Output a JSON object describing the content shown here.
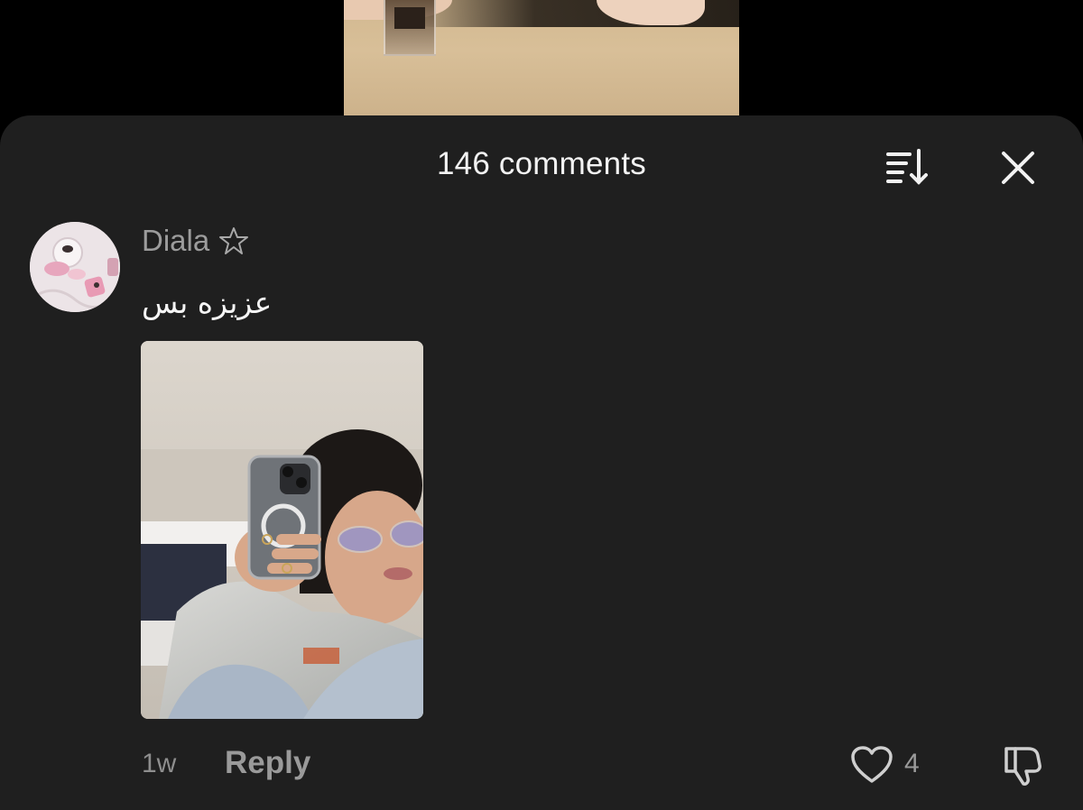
{
  "sheet": {
    "title": "146 comments",
    "sort_icon": "sort-icon",
    "close_icon": "close-icon"
  },
  "comment": {
    "username": "Diala",
    "badge_icon": "star-outline-icon",
    "text": "عزيزه بس",
    "timestamp": "1w",
    "reply_label": "Reply",
    "likes": "4",
    "like_icon": "heart-outline-icon",
    "dislike_icon": "thumbs-down-icon"
  },
  "colors": {
    "sheet_bg": "#1f1f1f",
    "title_text": "#f2f2f2",
    "muted_text": "#9a9a9a"
  }
}
